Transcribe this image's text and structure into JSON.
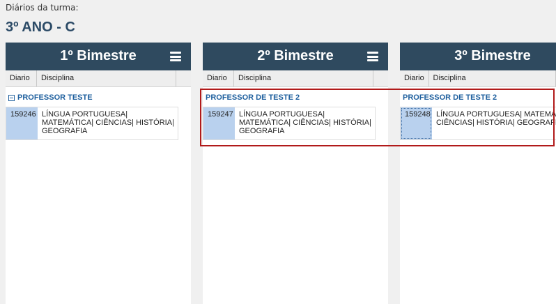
{
  "page": {
    "caption": "Diários da turma:",
    "title": "3º ANO - C"
  },
  "columns": [
    {
      "title": "1º Bimestre",
      "header": {
        "diario": "Diario",
        "disciplina": "Disciplina"
      },
      "group": "PROFESSOR TESTE",
      "row": {
        "diario": "159246",
        "disciplina": "LÍNGUA PORTUGUESA| MATEMÁTICA| CIÊNCIAS| HISTÓRIA| GEOGRAFIA"
      }
    },
    {
      "title": "2º Bimestre",
      "header": {
        "diario": "Diario",
        "disciplina": "Disciplina"
      },
      "group": "PROFESSOR DE TESTE 2",
      "row": {
        "diario": "159247",
        "disciplina": "LÍNGUA PORTUGUESA| MATEMÁTICA| CIÊNCIAS| HISTÓRIA| GEOGRAFIA"
      }
    },
    {
      "title": "3º Bimestre",
      "header": {
        "diario": "Diario",
        "disciplina": "Disciplina"
      },
      "group": "PROFESSOR DE TESTE 2",
      "row": {
        "diario": "159248",
        "disciplina": "LÍNGUA PORTUGUESA| MATEMÁTICA| CIÊNCIAS| HISTÓRIA| GEOGRAFIA"
      }
    }
  ],
  "icons": {
    "menu": "menu-icon",
    "collapse": "collapse-icon"
  },
  "colors": {
    "header_bg": "#2f4a5f",
    "group_text": "#1e5f9e",
    "diario_cell_bg": "#b9d1ee",
    "highlight_border": "#b11a1a"
  }
}
